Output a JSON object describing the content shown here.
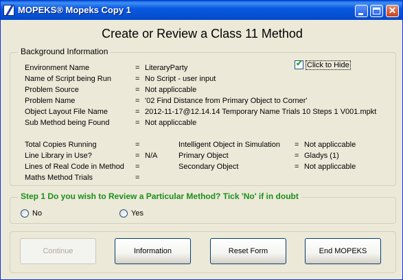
{
  "window": {
    "title": "MOPEKS® Mopeks Copy 1"
  },
  "heading": "Create or Review a Class 11 Method",
  "background": {
    "legend": "Background Information",
    "hide_checkbox": {
      "label": "Click to Hide",
      "checked": true,
      "check_glyph": "✔"
    },
    "equals": "=",
    "rows": [
      {
        "label": "Environment Name",
        "value": "LiteraryParty"
      },
      {
        "label": "Name of Script being Run",
        "value": "No Script - user input"
      },
      {
        "label": "Problem Source",
        "value": "Not appliccable"
      },
      {
        "label": "Problem Name",
        "value": "'02  Find Distance from Primary Object to Corner'"
      },
      {
        "label": "Object Layout File Name",
        "value": "2012-11-17@12.14.14 Temporary Name Trials 10 Steps 1 V001.mpkt"
      },
      {
        "label": "Sub Method being Found",
        "value": "Not appliccable"
      }
    ],
    "left_stats": [
      {
        "label": "Total Copies Running",
        "value": ""
      },
      {
        "label": "Line Library in Use?",
        "value": "N/A"
      },
      {
        "label": "Lines of Real Code in Method",
        "value": ""
      },
      {
        "label": "Maths Method Trials",
        "value": ""
      }
    ],
    "right_stats": [
      {
        "label": "Intelligent Object in Simulation",
        "value": "Not appliccable"
      },
      {
        "label": "Primary Object",
        "value": "Gladys (1)"
      },
      {
        "label": "Secondary Object",
        "value": "Not appliccable"
      }
    ]
  },
  "step1": {
    "legend": "Step 1   Do you wish to Review a Particular Method? Tick 'No' if in doubt",
    "options": [
      "No",
      "Yes"
    ]
  },
  "buttons": {
    "continue": "Continue",
    "information": "Information",
    "reset": "Reset Form",
    "end": "End MOPEKS"
  },
  "colors": {
    "step_legend": "#1a8f1a",
    "titlebar": "#0a58e0"
  }
}
